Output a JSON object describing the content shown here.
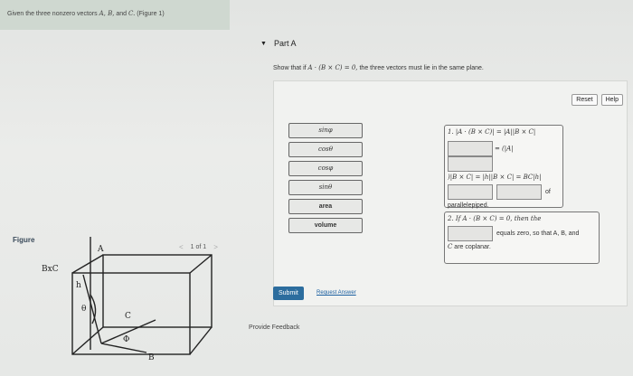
{
  "prompt": {
    "text_before": "Given the three nonzero vectors ",
    "math_vectors": "A, B,",
    "text_and": " and ",
    "math_c": "C.",
    "text_after": " (Figure 1)"
  },
  "figure_panel": {
    "label": "Figure",
    "pager_prev": "<",
    "pager_text": "1 of 1",
    "pager_next": ">",
    "figure_labels": {
      "a": "A",
      "b": "B",
      "c": "C",
      "bxc": "BxC",
      "h": "h",
      "theta": "θ",
      "phi": "Φ"
    }
  },
  "part": {
    "toggle": "▼",
    "title": "Part A",
    "question_before": "Show that if ",
    "question_math": "A · (B × C) = 0,",
    "question_after": " the three vectors must lie in the same plane."
  },
  "tools": {
    "reset": "Reset",
    "help": "Help"
  },
  "drag_items": [
    "sinφ",
    "cosθ",
    "cosφ",
    "sinθ",
    "area",
    "volume"
  ],
  "proof1": {
    "line1": "1. |A · (B × C)| = |A||B × C|",
    "line2": "= (|A|",
    "line3": ")|B × C| = |h||B × C| = BC|h|",
    "of": "of",
    "parallelepiped": "parallelepiped."
  },
  "proof2": {
    "line1": "2. If A · (B × C) = 0, then the",
    "line2": "equals zero, so that A, B, and",
    "line3_math": "C",
    "line3": " are coplanar."
  },
  "actions": {
    "submit": "Submit",
    "request": "Request Answer",
    "feedback": "Provide Feedback"
  }
}
